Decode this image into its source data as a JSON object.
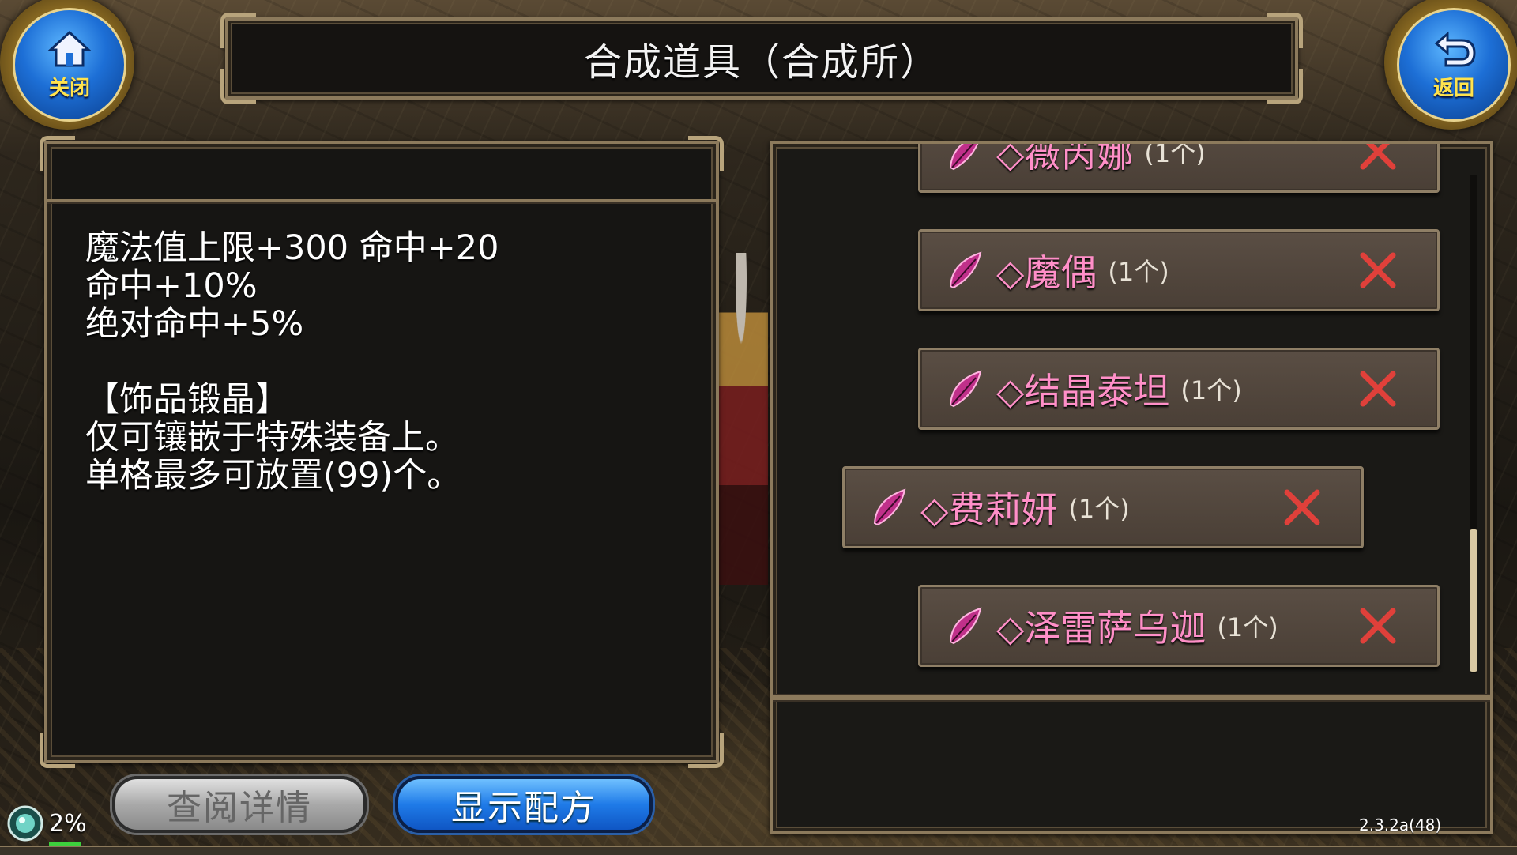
{
  "title": "合成道具（合成所）",
  "close_button": {
    "label": "关闭",
    "icon": "home-icon"
  },
  "back_button": {
    "label": "返回",
    "icon": "back-arrow-icon"
  },
  "description": [
    "魔法值上限+300 命中+20",
    "命中+10%",
    "绝对命中+5%",
    "",
    "【饰品锻晶】",
    "仅可镶嵌于特殊装备上。",
    "单格最多可放置(99)个。"
  ],
  "materials": [
    {
      "name": "◇薇芮娜",
      "qty": "(1个)"
    },
    {
      "name": "◇魔偶",
      "qty": "(1个)"
    },
    {
      "name": "◇结晶泰坦",
      "qty": "(1个)"
    },
    {
      "name": "◇费莉妍",
      "qty": "(1个)"
    },
    {
      "name": "◇泽雷萨乌迦",
      "qty": "(1个)"
    }
  ],
  "buttons": {
    "details": "查阅详情",
    "show_recipe": "显示配方"
  },
  "status": {
    "progress": "2%",
    "version": "2.3.2a(48)"
  },
  "colors": {
    "item_name": "#ff8fc8",
    "remove_x": "#e0403a",
    "panel_border": "#8c7a5c",
    "recipe_button": "#1f7be8"
  }
}
